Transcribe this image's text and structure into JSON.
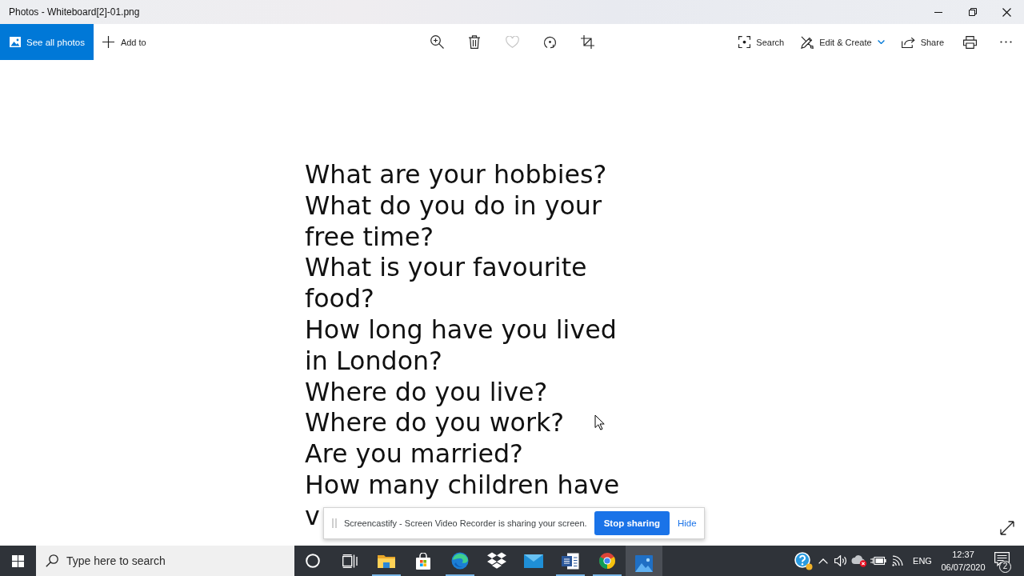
{
  "window": {
    "title": "Photos - Whiteboard[2]-01.png"
  },
  "toolbar": {
    "see_all": {
      "label": "See all photos"
    },
    "add_to": {
      "label": "Add to"
    },
    "tools": [
      {
        "kind": "zoom",
        "disabled": false
      },
      {
        "kind": "delete",
        "disabled": false
      },
      {
        "kind": "favorite",
        "disabled": true
      },
      {
        "kind": "rotate",
        "disabled": false
      },
      {
        "kind": "crop",
        "disabled": false
      }
    ],
    "actions": [
      {
        "kind": "search",
        "label": "Search",
        "dropdown": false
      },
      {
        "kind": "edit",
        "label": "Edit & Create",
        "dropdown": true
      },
      {
        "kind": "share",
        "label": "Share",
        "dropdown": false
      },
      {
        "kind": "print"
      },
      {
        "kind": "more"
      }
    ]
  },
  "image": {
    "lines": [
      "What are your hobbies?",
      "What do you do in your",
      "free time?",
      "What is your favourite",
      "food?",
      "How long have you lived",
      "in London?",
      "Where do you live?",
      "Where do you work?",
      "Are you married?",
      "How many children have",
      "v"
    ]
  },
  "share_bar": {
    "message": "Screencastify - Screen Video Recorder is sharing your screen.",
    "stop_button": "Stop sharing",
    "hide_link": "Hide"
  },
  "taskbar": {
    "search": {
      "placeholder": "Type here to search"
    },
    "apps": [
      {
        "kind": "cortana",
        "running": false,
        "active": false
      },
      {
        "kind": "taskview",
        "running": false,
        "active": false
      },
      {
        "kind": "explorer",
        "running": true,
        "active": false
      },
      {
        "kind": "store",
        "running": false,
        "active": false
      },
      {
        "kind": "edge",
        "running": true,
        "active": false
      },
      {
        "kind": "dropbox",
        "running": false,
        "active": false
      },
      {
        "kind": "mail",
        "running": false,
        "active": false
      },
      {
        "kind": "word",
        "running": true,
        "active": false
      },
      {
        "kind": "chrome",
        "running": true,
        "active": false
      },
      {
        "kind": "photos",
        "running": true,
        "active": true
      }
    ],
    "tray": {
      "language": "ENG",
      "time": "12:37",
      "date": "06/07/2020",
      "notifications": "2"
    }
  }
}
